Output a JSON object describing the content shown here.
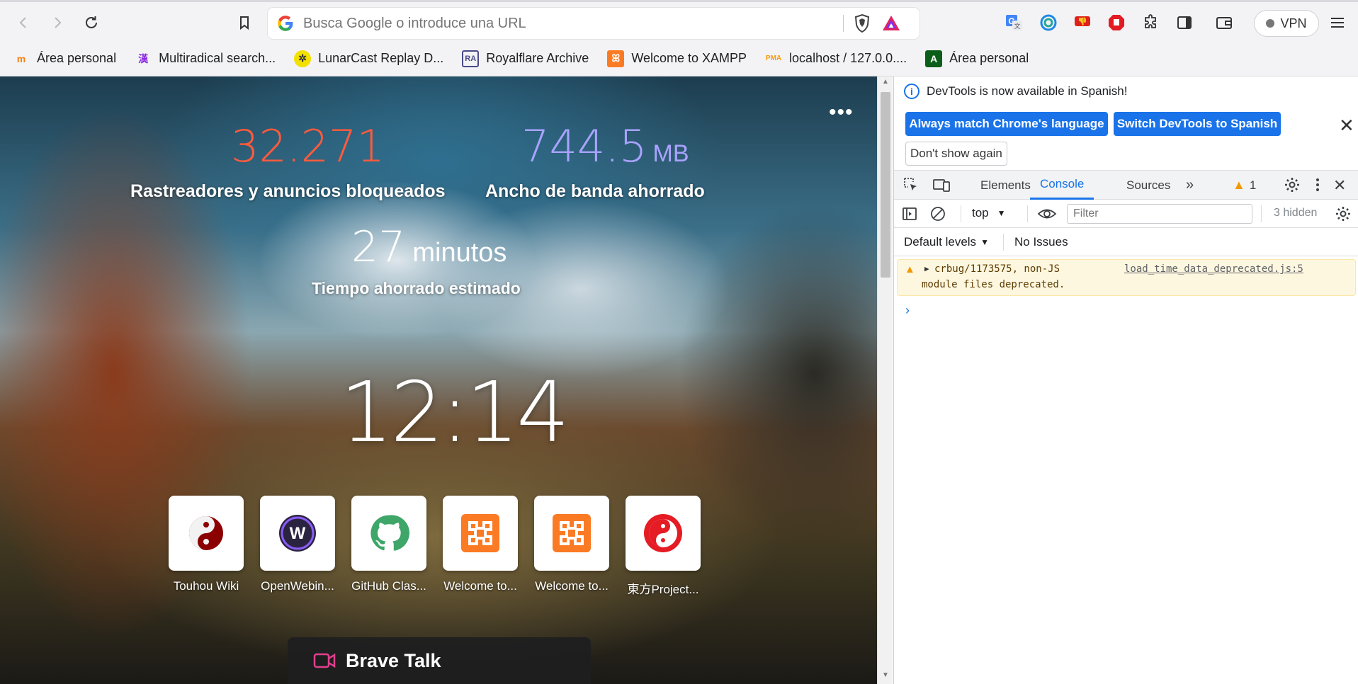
{
  "toolbar": {
    "omnibox_placeholder": "Busca Google o introduce una URL",
    "vpn_label": "VPN"
  },
  "bookmarks": [
    {
      "label": "Área personal",
      "icon": "moodle-icon",
      "color": "#f98012"
    },
    {
      "label": "Multiradical search...",
      "icon": "kanji-icon",
      "color": "#8a2be2"
    },
    {
      "label": "LunarCast Replay D...",
      "icon": "lunarcast-icon",
      "color": "#e5d100"
    },
    {
      "label": "Royalflare Archive",
      "icon": "royalflare-icon",
      "color": "#4a4a8a"
    },
    {
      "label": "Welcome to XAMPP",
      "icon": "xampp-icon",
      "color": "#fb7a24"
    },
    {
      "label": "localhost / 127.0.0....",
      "icon": "phpmyadmin-icon",
      "color": "#f89c0e"
    },
    {
      "label": "Área personal",
      "icon": "area-icon",
      "color": "#0b5e1a"
    }
  ],
  "ntp": {
    "trackers_value": "32.271",
    "trackers_label": "Rastreadores y anuncios bloqueados",
    "bandwidth_value": "744.5",
    "bandwidth_unit": "MB",
    "bandwidth_label": "Ancho de banda ahorrado",
    "time_value": "27",
    "time_unit": "minutos",
    "time_label": "Tiempo ahorrado estimado",
    "clock": "12:14",
    "tiles": [
      {
        "label": "Touhou Wiki",
        "icon": "touhou-wiki-icon"
      },
      {
        "label": "OpenWebin...",
        "icon": "openwebinars-icon"
      },
      {
        "label": "GitHub Clas...",
        "icon": "github-icon"
      },
      {
        "label": "Welcome to...",
        "icon": "xampp-icon"
      },
      {
        "label": "Welcome to...",
        "icon": "xampp-icon"
      },
      {
        "label": "東方Project...",
        "icon": "touhou-project-icon"
      }
    ],
    "brave_talk": "Brave Talk",
    "colors": {
      "trackers": "#ff5a3c",
      "bandwidth": "#a9a3ff"
    }
  },
  "devtools": {
    "info_message": "DevTools is now available in Spanish!",
    "btn_match": "Always match Chrome's language",
    "btn_switch": "Switch DevTools to Spanish",
    "btn_dont_show": "Don't show again",
    "tabs": [
      "Elements",
      "Console",
      "Sources"
    ],
    "active_tab": "Console",
    "warning_count": "1",
    "context": "top",
    "filter_placeholder": "Filter",
    "hidden_count": "3 hidden",
    "default_levels": "Default levels",
    "no_issues": "No Issues",
    "warning_text_1": "crbug/1173575, non-JS",
    "warning_text_2": "module files deprecated.",
    "warning_source": "load_time_data_deprecated.js:5"
  }
}
